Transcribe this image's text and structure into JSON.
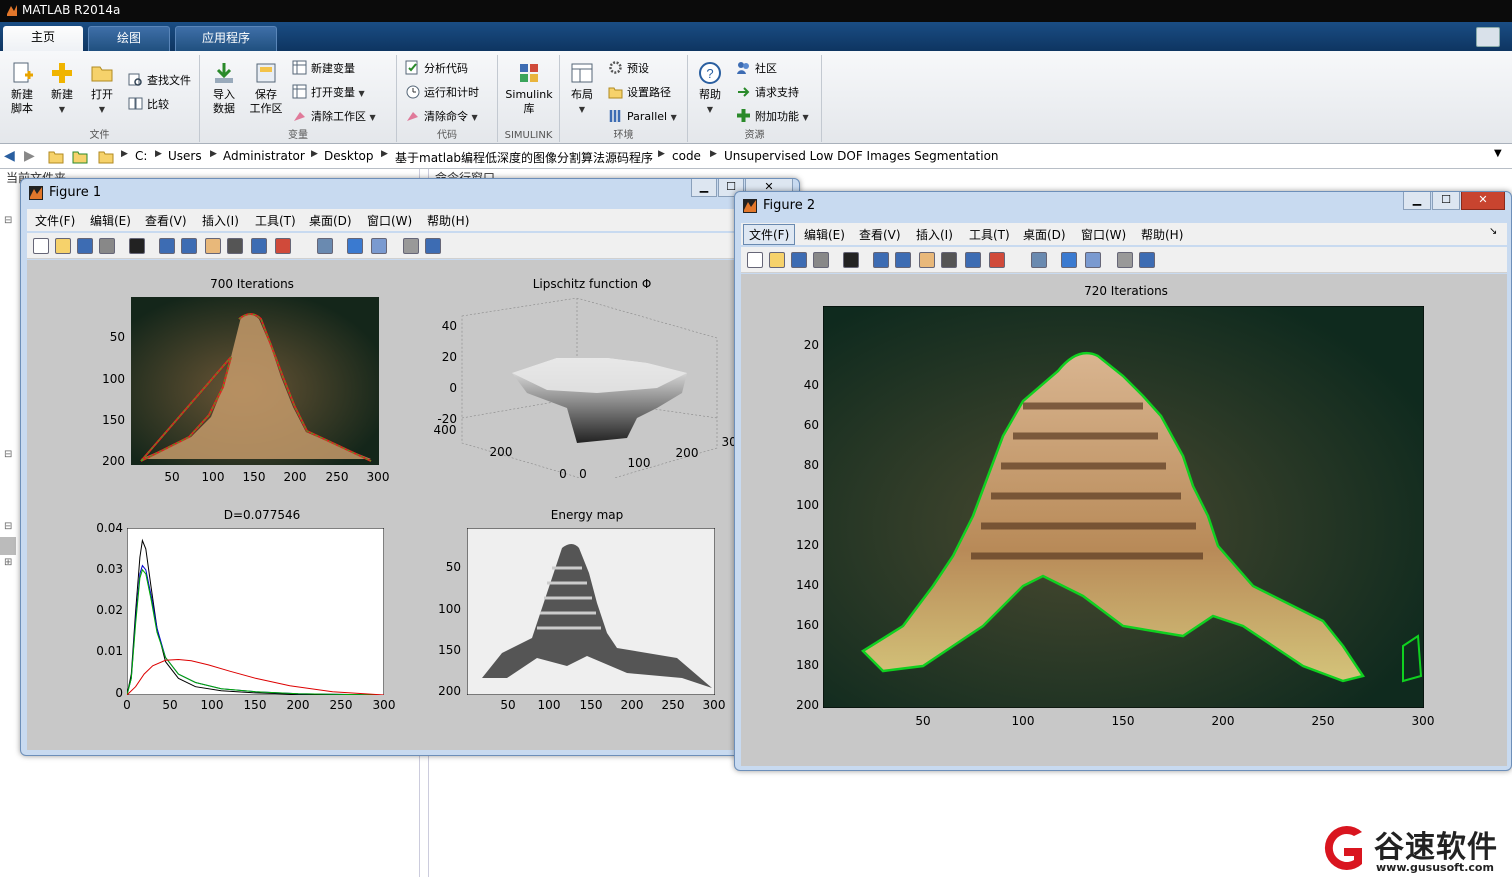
{
  "app": {
    "title": "MATLAB R2014a"
  },
  "tabs": [
    {
      "label": "主页"
    },
    {
      "label": "绘图"
    },
    {
      "label": "应用程序"
    }
  ],
  "ribbon": {
    "file": {
      "label": "文件",
      "new_script": "新建\n脚本",
      "new": "新建",
      "open": "打开",
      "find_files": "查找文件",
      "compare": "比较"
    },
    "variable": {
      "label": "变量",
      "import": "导入\n数据",
      "save_ws": "保存\n工作区",
      "new_var": "新建变量",
      "open_var": "打开变量",
      "clear_ws": "清除工作区"
    },
    "code": {
      "label": "代码",
      "analyze": "分析代码",
      "run_time": "运行和计时",
      "clear_cmd": "清除命令"
    },
    "simulink": {
      "label": "SIMULINK",
      "library": "Simulink\n库"
    },
    "env": {
      "label": "环境",
      "layout": "布局",
      "prefs": "预设",
      "set_path": "设置路径",
      "parallel": "Parallel"
    },
    "resources": {
      "label": "资源",
      "help": "帮助",
      "community": "社区",
      "support": "请求支持",
      "addons": "附加功能"
    }
  },
  "address": {
    "parts": [
      "C:",
      "Users",
      "Administrator",
      "Desktop",
      "基于matlab编程低深度的图像分割算法源码程序",
      "code",
      "Unsupervised Low DOF Images Segmentation"
    ]
  },
  "panes": {
    "left_title": "当前文件夹",
    "mid_title": "命令行窗口"
  },
  "menus": [
    "文件(F)",
    "编辑(E)",
    "查看(V)",
    "插入(I)",
    "工具(T)",
    "桌面(D)",
    "窗口(W)",
    "帮助(H)"
  ],
  "figure1": {
    "title": "Figure 1",
    "plots": {
      "p1": {
        "title": "700 Iterations",
        "yticks": [
          "50",
          "100",
          "150",
          "200"
        ],
        "xticks": [
          "50",
          "100",
          "150",
          "200",
          "250",
          "300"
        ]
      },
      "p2": {
        "title": "Lipschitz function Φ",
        "zticks": [
          "40",
          "20",
          "0",
          "-20"
        ],
        "xticks_l": [
          "400",
          "200",
          "0"
        ],
        "xticks_r": [
          "0",
          "100",
          "200",
          "300"
        ]
      },
      "p3": {
        "title": "D=0.077546",
        "yticks": [
          "0.04",
          "0.03",
          "0.02",
          "0.01",
          "0"
        ],
        "xticks": [
          "0",
          "50",
          "100",
          "150",
          "200",
          "250",
          "300"
        ]
      },
      "p4": {
        "title": "Energy map",
        "yticks": [
          "50",
          "100",
          "150",
          "200"
        ],
        "xticks": [
          "50",
          "100",
          "150",
          "200",
          "250",
          "300"
        ]
      }
    }
  },
  "figure2": {
    "title": "Figure 2",
    "plot": {
      "title": "720 Iterations",
      "yticks": [
        "20",
        "40",
        "60",
        "80",
        "100",
        "120",
        "140",
        "160",
        "180",
        "200"
      ],
      "xticks": [
        "50",
        "100",
        "150",
        "200",
        "250",
        "300"
      ]
    }
  },
  "chart_data": {
    "type": "line",
    "title": "D=0.077546",
    "xlim": [
      0,
      300
    ],
    "ylim": [
      0,
      0.04
    ],
    "series": [
      {
        "color": "#000000",
        "x": [
          0,
          5,
          10,
          15,
          18,
          22,
          28,
          35,
          45,
          60,
          80,
          110,
          150,
          200,
          300
        ],
        "y": [
          0,
          0.005,
          0.02,
          0.033,
          0.037,
          0.035,
          0.026,
          0.016,
          0.008,
          0.004,
          0.002,
          0.001,
          0.0005,
          0.0002,
          0
        ]
      },
      {
        "color": "#0000cc",
        "x": [
          0,
          5,
          10,
          15,
          18,
          22,
          28,
          35,
          45,
          60,
          80,
          110,
          150,
          200,
          300
        ],
        "y": [
          0,
          0.004,
          0.018,
          0.029,
          0.031,
          0.03,
          0.024,
          0.016,
          0.009,
          0.005,
          0.003,
          0.0015,
          0.0008,
          0.0003,
          0
        ]
      },
      {
        "color": "#00aa00",
        "x": [
          0,
          5,
          10,
          15,
          18,
          22,
          28,
          35,
          45,
          60,
          80,
          110,
          150,
          200,
          300
        ],
        "y": [
          0,
          0.004,
          0.017,
          0.028,
          0.03,
          0.029,
          0.023,
          0.015,
          0.009,
          0.005,
          0.003,
          0.0015,
          0.0008,
          0.0003,
          0
        ]
      },
      {
        "color": "#dd0000",
        "x": [
          0,
          10,
          20,
          30,
          45,
          60,
          75,
          95,
          120,
          150,
          190,
          240,
          300
        ],
        "y": [
          0,
          0.002,
          0.005,
          0.007,
          0.0083,
          0.0085,
          0.0082,
          0.0072,
          0.0057,
          0.004,
          0.0022,
          0.0008,
          0
        ]
      }
    ]
  },
  "watermark": {
    "brand": "谷速软件",
    "url": "www.gususoft.com"
  },
  "colors": {
    "accent": "#0e3561",
    "figure_bg": "#c8c8c8",
    "brand_red": "#d9151f"
  }
}
